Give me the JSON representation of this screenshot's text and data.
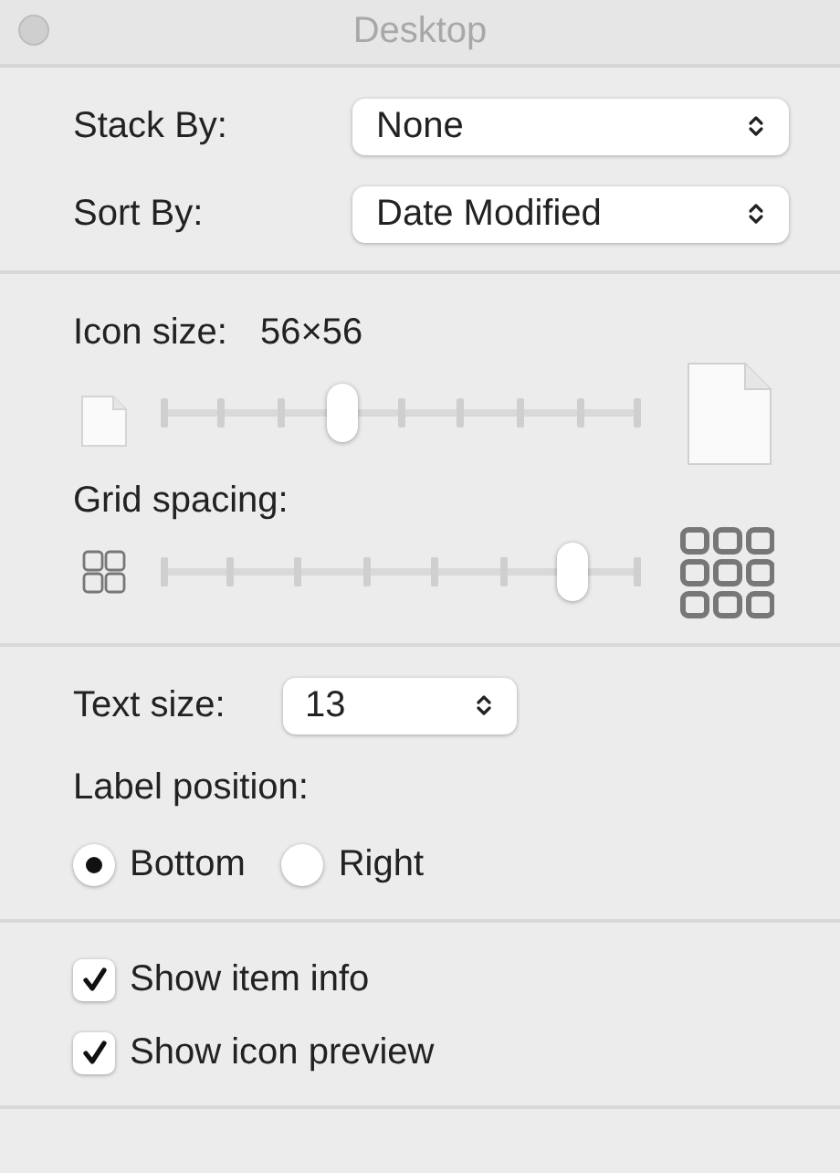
{
  "window": {
    "title": "Desktop"
  },
  "arrangement": [
    {
      "label": "Stack By:",
      "value": "None"
    },
    {
      "label": "Sort By:",
      "value": "Date Modified"
    }
  ],
  "icon_size": {
    "label": "Icon size:",
    "reading": "56×56",
    "level": 0.375
  },
  "grid_spacing": {
    "label": "Grid spacing:",
    "level": 0.857
  },
  "text_size": {
    "label": "Text size:",
    "value": "13"
  },
  "label_position": {
    "label": "Label position:",
    "options": [
      {
        "label": "Bottom",
        "selected": true
      },
      {
        "label": "Right",
        "selected": false
      }
    ]
  },
  "options": [
    {
      "label": "Show item info",
      "checked": true
    },
    {
      "label": "Show icon preview",
      "checked": true
    }
  ]
}
